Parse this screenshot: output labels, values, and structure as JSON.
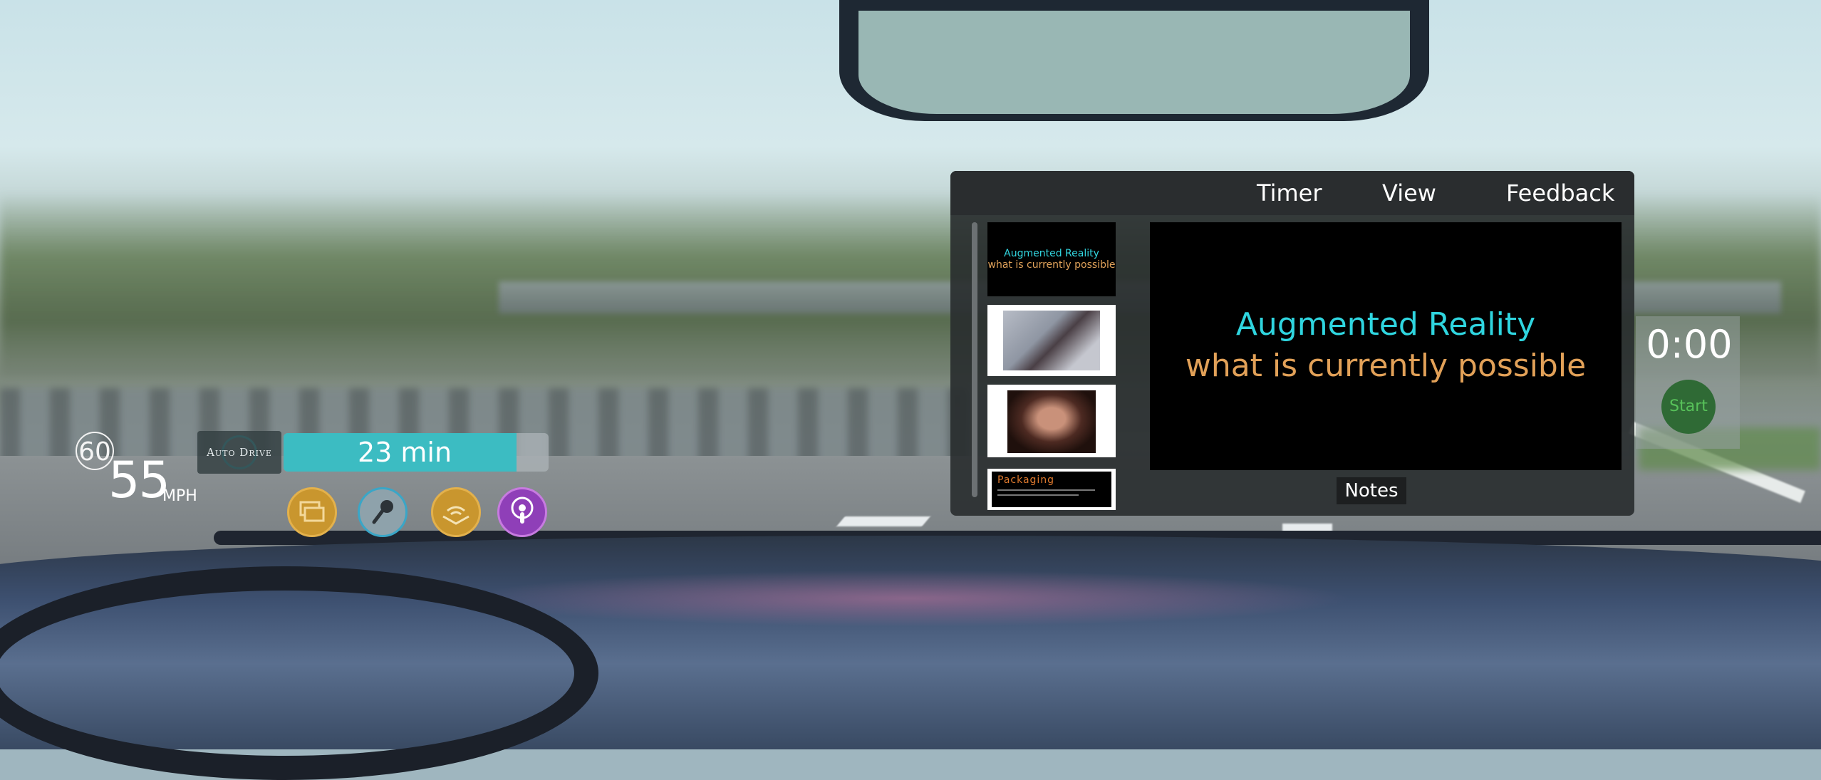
{
  "hud": {
    "speed_limit": "60",
    "speed": "55",
    "speed_unit": "MPH",
    "auto_drive_label": "Auto Drive",
    "eta": "23 min",
    "eta_progress": 0.88,
    "apps": [
      {
        "icon": "media-screens-icon",
        "color": "#c9962e"
      },
      {
        "icon": "microphone-icon",
        "color": "#8ea2ab"
      },
      {
        "icon": "audible-icon",
        "color": "#c9962e"
      },
      {
        "icon": "podcast-icon",
        "color": "#8f3fb8"
      }
    ]
  },
  "presentation": {
    "menu": {
      "timer": "Timer",
      "view": "View",
      "feedback": "Feedback"
    },
    "thumbnails": [
      {
        "title": "Augmented Reality",
        "subtitle": "what is currently possible"
      },
      {
        "image": "person-vr-headset"
      },
      {
        "image": "person-ar-glasses"
      },
      {
        "title": "Packaging"
      }
    ],
    "slide": {
      "title": "Augmented Reality",
      "subtitle": "what is currently possible",
      "title_color": "#2fd5df",
      "subtitle_color": "#e2a158"
    },
    "notes_label": "Notes"
  },
  "timer": {
    "value": "0:00",
    "start_label": "Start"
  },
  "colors": {
    "accent_teal": "#3cbcc2",
    "start_green": "#2f6a35"
  }
}
